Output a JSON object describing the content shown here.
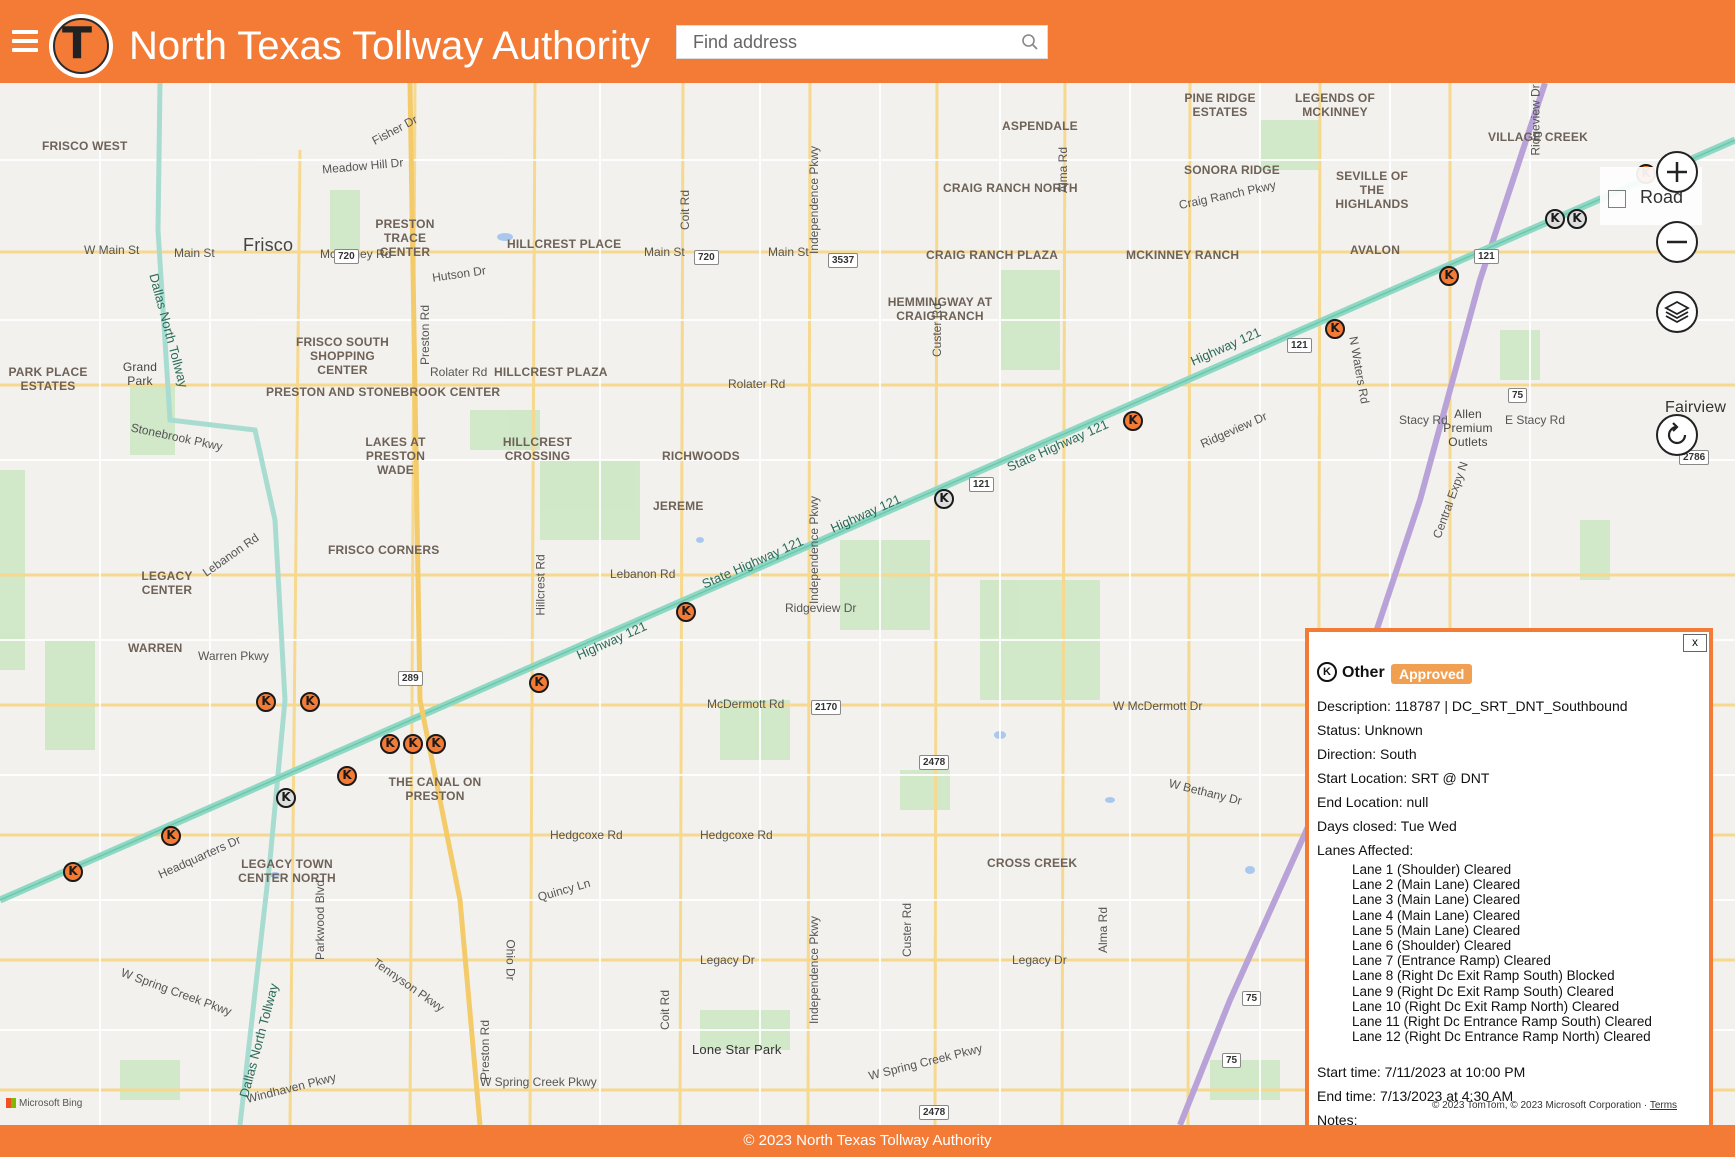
{
  "header": {
    "title": "North Texas Tollway Authority",
    "logo_letter": "T",
    "search_placeholder": "Find address",
    "brand_color": "#f47b35"
  },
  "icons": {
    "menu": "hamburger-menu-icon",
    "search": "search-icon",
    "zoom_in": "plus-icon",
    "zoom_out": "minus-icon",
    "layers": "layers-icon",
    "reset": "rotate-icon",
    "closure": "k-marker-icon"
  },
  "map": {
    "style_label": "Road",
    "place_labels": [
      "FRISCO WEST",
      "PRESTON TRACE CENTER",
      "Frisco",
      "HILLCREST PLACE",
      "ASPENDALE",
      "PINE RIDGE ESTATES",
      "LEGENDS OF MCKINNEY",
      "VILLAGE CREEK",
      "CRAIG RANCH NORTH",
      "SONORA RIDGE",
      "SEVILLE OF THE HIGHLANDS",
      "CRAIG RANCH PLAZA",
      "MCKINNEY RANCH",
      "AVALON",
      "HEMMINGWAY AT CRAIG RANCH",
      "FRISCO SOUTH SHOPPING CENTER",
      "PARK PLACE ESTATES",
      "Grand Park",
      "HILLCREST PLAZA",
      "PRESTON AND STONEBROOK CENTER",
      "LAKES AT PRESTON WADE",
      "HILLCREST CROSSING",
      "RICHWOODS",
      "JEREME",
      "FRISCO CORNERS",
      "LEGACY CENTER",
      "WARREN",
      "THE CANAL ON PRESTON",
      "LEGACY TOWN CENTER NORTH",
      "CROSS CREEK",
      "Lone Star Park",
      "Fairview",
      "Allen Premium Outlets"
    ],
    "road_labels": [
      "W Main St",
      "Main St",
      "Meadow Hill Dr",
      "Fisher Dr",
      "McKinney Rd",
      "Hutson Dr",
      "Main St",
      "Main St",
      "Rolater Rd",
      "Rolater Rd",
      "Stonebrook Pkwy",
      "Lebanon Rd",
      "Lebanon Rd",
      "Warren Pkwy",
      "McDermott Rd",
      "W McDermott Dr",
      "Ridgeview Dr",
      "Ridgeview Dr",
      "Hedgcoxe Rd",
      "Hedgcoxe Rd",
      "Headquarters Dr",
      "Quincy Ln",
      "Legacy Dr",
      "Legacy Dr",
      "Tennyson Pkwy",
      "W Spring Creek Pkwy",
      "W Spring Creek Pkwy",
      "W Spring Creek Pkwy",
      "Windhaven Pkwy",
      "Stacy Rd",
      "E Stacy Rd",
      "Highway 121",
      "State Highway 121",
      "Highway 121",
      "State Highway 121",
      "Highway 121",
      "Dallas North Tollway",
      "Dallas North Tollway",
      "Independence Pkwy",
      "Independence Pkwy",
      "Independence Pkwy",
      "Custer Rd",
      "Custer Rd",
      "Alma Rd",
      "Alma Rd",
      "Preston Rd",
      "Preston Rd",
      "Hillcrest Rd",
      "Coit Rd",
      "Coit Rd",
      "N Waters Rd",
      "Central Expy N",
      "Parkwood Blvd",
      "Ohio Dr",
      "W Bethany Dr",
      "Craig Ranch Pkwy",
      "Ridgeview Dr"
    ],
    "shields": [
      "720",
      "720",
      "3537",
      "121",
      "121",
      "121",
      "289",
      "2170",
      "2478",
      "2478",
      "75",
      "75",
      "75",
      "2786"
    ],
    "attribution_left": "Microsoft Bing",
    "attribution_right": "© 2023 TomTom, © 2023 Microsoft Corporation",
    "terms": "Terms"
  },
  "popup": {
    "close": "x",
    "type": "Other",
    "badge": "Approved",
    "badge_color": "#f0a050",
    "description": "Description: 118787 | DC_SRT_DNT_Southbound",
    "status": "Status: Unknown",
    "direction": "Direction: South",
    "start_location": "Start Location: SRT @ DNT",
    "end_location": "End Location: null",
    "days_closed": "Days closed: Tue Wed",
    "lanes_title": "Lanes Affected:",
    "lanes": [
      "Lane 1 (Shoulder) Cleared",
      "Lane 2 (Main Lane) Cleared",
      "Lane 3 (Main Lane) Cleared",
      "Lane 4 (Main Lane) Cleared",
      "Lane 5 (Main Lane) Cleared",
      "Lane 6 (Shoulder) Cleared",
      "Lane 7 (Entrance Ramp) Cleared",
      "Lane 8 (Right Dc Exit Ramp South) Blocked",
      "Lane 9 (Right Dc Exit Ramp South) Cleared",
      "Lane 10 (Right Dc Exit Ramp North) Cleared",
      "Lane 11 (Right Dc Entrance Ramp South) Cleared",
      "Lane 12 (Right Dc Entrance Ramp North) Cleared"
    ],
    "start_time": "Start time: 7/11/2023 at 10:00 PM",
    "end_time": "End time: 7/13/2023 at 4:30 AM",
    "notes": "Notes:"
  },
  "footer": {
    "text": "© 2023 North Texas Tollway Authority"
  }
}
